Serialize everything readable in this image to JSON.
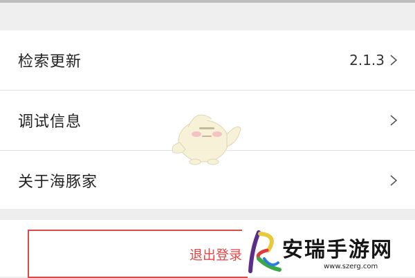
{
  "menu": {
    "items": [
      {
        "label": "检索更新",
        "value": "2.1.3"
      },
      {
        "label": "调试信息",
        "value": ""
      },
      {
        "label": "关于海豚家",
        "value": ""
      }
    ]
  },
  "logout": {
    "label": "退出登录"
  },
  "watermark": {
    "name": "安瑞手游网",
    "url": "www.szerg.com"
  },
  "colors": {
    "accent": "#e84545",
    "divider": "#e2e2e2",
    "background": "#eeeeee"
  },
  "icons": {
    "chevron": "chevron-right-icon"
  }
}
